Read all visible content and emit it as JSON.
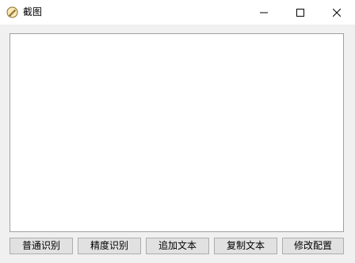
{
  "window": {
    "title": "截图",
    "icon": "pen-circle-icon",
    "controls": [
      "minimize-icon",
      "maximize-icon",
      "close-icon"
    ]
  },
  "content": {
    "text": ""
  },
  "buttons": {
    "normal_ocr": "普通识别",
    "accurate_ocr": "精度识别",
    "append_text": "追加文本",
    "copy_text": "复制文本",
    "modify_config": "修改配置"
  }
}
